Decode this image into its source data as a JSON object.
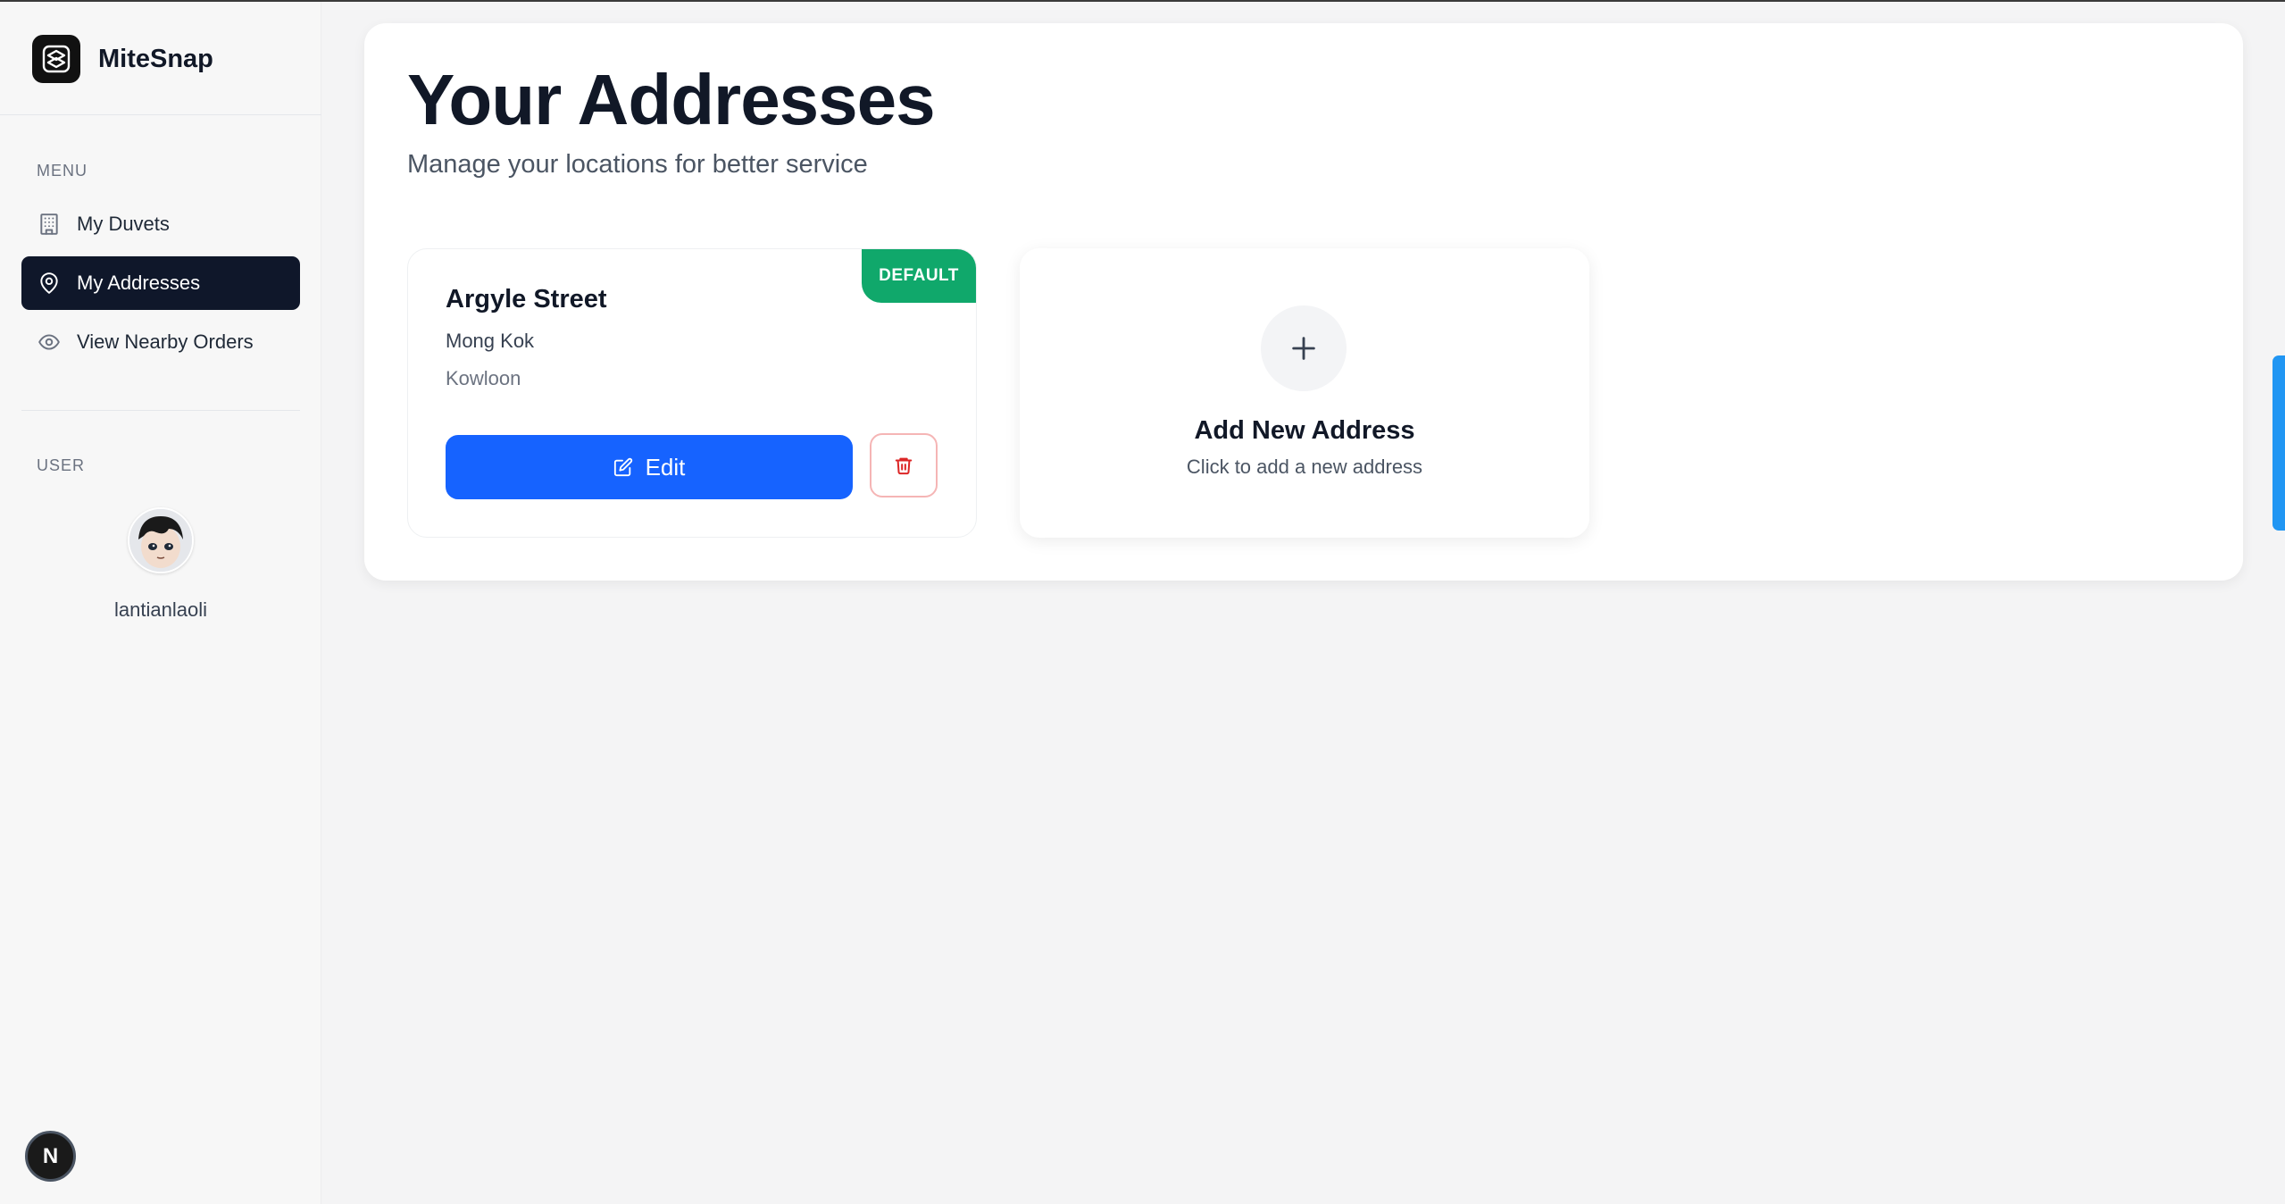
{
  "app": {
    "name": "MiteSnap",
    "logo_icon": "mitesnap-logo-icon"
  },
  "sidebar": {
    "menu_label": "MENU",
    "items": [
      {
        "label": "My Duvets",
        "icon": "building-icon",
        "active": false
      },
      {
        "label": "My Addresses",
        "icon": "map-pin-icon",
        "active": true
      },
      {
        "label": "View Nearby Orders",
        "icon": "eye-icon",
        "active": false
      }
    ],
    "user_label": "USER",
    "username": "lantianlaoli",
    "dev_badge": "N"
  },
  "main": {
    "title": "Your Addresses",
    "subtitle": "Manage your locations for better service",
    "addresses": [
      {
        "street": "Argyle Street",
        "district": "Mong Kok",
        "region": "Kowloon",
        "badge": "DEFAULT",
        "edit_label": "Edit"
      }
    ],
    "add_card": {
      "title": "Add New Address",
      "subtitle": "Click to add a new address"
    }
  },
  "colors": {
    "active_nav": "#0f172a",
    "primary": "#1663ff",
    "default_badge": "#10a86b",
    "delete": "#dc2626"
  }
}
